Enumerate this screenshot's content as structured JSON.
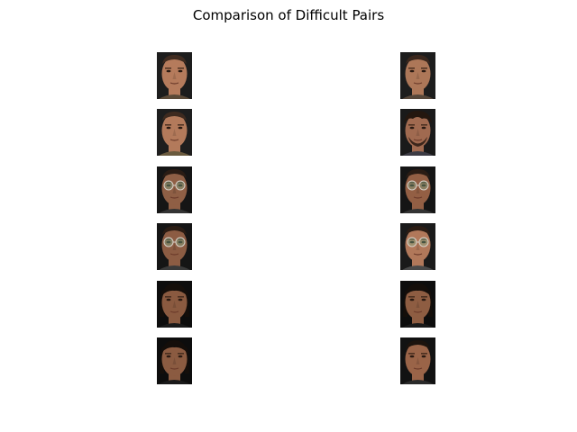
{
  "figure": {
    "title": "Comparison of Difficult Pairs"
  },
  "pairs": [
    {
      "left": {
        "skin": "#b57b5c",
        "hair": "#3f2b20",
        "bg": "#1d1d1d",
        "shirt": "#5b4a38",
        "glasses": false,
        "beard": false,
        "hair_style": "short"
      },
      "right": {
        "skin": "#ad7758",
        "hair": "#3a271d",
        "bg": "#1d1d1d",
        "shirt": "#56473a",
        "glasses": false,
        "beard": false,
        "hair_style": "short"
      }
    },
    {
      "left": {
        "skin": "#b37a5b",
        "hair": "#3e2a1f",
        "bg": "#1e1e1e",
        "shirt": "#6a5a3e",
        "glasses": false,
        "beard": false,
        "hair_style": "short"
      },
      "right": {
        "skin": "#a06a50",
        "hair": "#24170f",
        "bg": "#1a1a1a",
        "shirt": "#3c3b44",
        "glasses": false,
        "beard": true,
        "hair_style": "messy"
      }
    },
    {
      "left": {
        "skin": "#8f5f45",
        "hair": "#2a1c14",
        "bg": "#151515",
        "shirt": "#333333",
        "glasses": true,
        "beard": false,
        "hair_style": "short"
      },
      "right": {
        "skin": "#935f44",
        "hair": "#2a1c14",
        "bg": "#151515",
        "shirt": "#333333",
        "glasses": true,
        "beard": false,
        "hair_style": "short"
      }
    },
    {
      "left": {
        "skin": "#8c5c43",
        "hair": "#2a1c14",
        "bg": "#151515",
        "shirt": "#3a3a3a",
        "glasses": true,
        "beard": false,
        "hair_style": "short"
      },
      "right": {
        "skin": "#b1785a",
        "hair": "#2b1c14",
        "bg": "#1a1a1a",
        "shirt": "#4a4a4a",
        "glasses": true,
        "beard": false,
        "hair_style": "short"
      }
    },
    {
      "left": {
        "skin": "#8a5a40",
        "hair": "#140e0a",
        "bg": "#0d0d0d",
        "shirt": "#1a1a1a",
        "glasses": false,
        "beard": false,
        "hair_style": "long"
      },
      "right": {
        "skin": "#8e5d42",
        "hair": "#140e0a",
        "bg": "#0d0d0d",
        "shirt": "#1a1a1a",
        "glasses": false,
        "beard": false,
        "hair_style": "long"
      }
    },
    {
      "left": {
        "skin": "#8b5b41",
        "hair": "#140e0a",
        "bg": "#0d0d0d",
        "shirt": "#1a1a1a",
        "glasses": false,
        "beard": false,
        "hair_style": "long"
      },
      "right": {
        "skin": "#9a6448",
        "hair": "#1c130d",
        "bg": "#121212",
        "shirt": "#2a2a2a",
        "glasses": false,
        "beard": false,
        "hair_style": "short"
      }
    }
  ]
}
